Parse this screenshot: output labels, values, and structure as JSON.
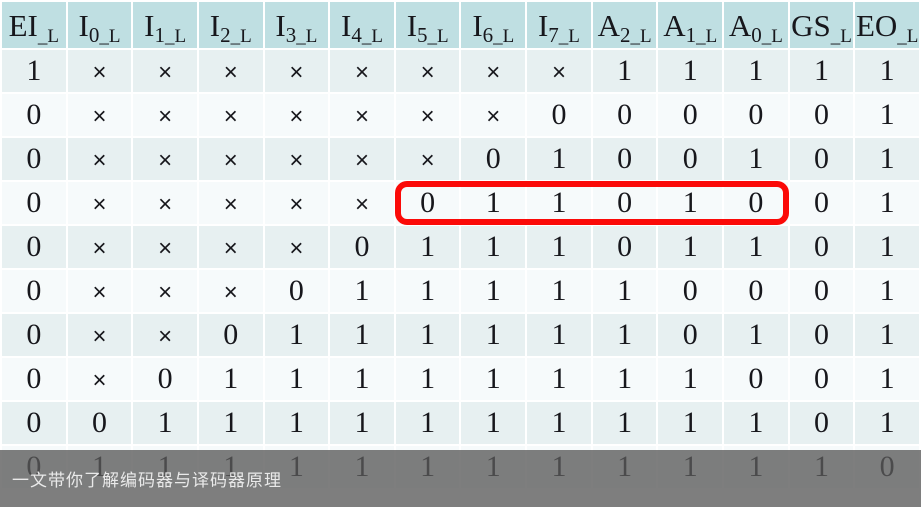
{
  "table": {
    "columns": [
      {
        "main": "EI",
        "sub": "_L",
        "index": ""
      },
      {
        "main": "I",
        "sub": "_L",
        "index": "0"
      },
      {
        "main": "I",
        "sub": "_L",
        "index": "1"
      },
      {
        "main": "I",
        "sub": "_L",
        "index": "2"
      },
      {
        "main": "I",
        "sub": "_L",
        "index": "3"
      },
      {
        "main": "I",
        "sub": "_L",
        "index": "4"
      },
      {
        "main": "I",
        "sub": "_L",
        "index": "5"
      },
      {
        "main": "I",
        "sub": "_L",
        "index": "6"
      },
      {
        "main": "I",
        "sub": "_L",
        "index": "7"
      },
      {
        "main": "A",
        "sub": "_L",
        "index": "2"
      },
      {
        "main": "A",
        "sub": "_L",
        "index": "1"
      },
      {
        "main": "A",
        "sub": "_L",
        "index": "0"
      },
      {
        "main": "GS",
        "sub": "_L",
        "index": ""
      },
      {
        "main": "EO",
        "sub": "_L",
        "index": ""
      }
    ],
    "column_labels": [
      "EI_L",
      "I0_L",
      "I1_L",
      "I2_L",
      "I3_L",
      "I4_L",
      "I5_L",
      "I6_L",
      "I7_L",
      "A2_L",
      "A1_L",
      "A0_L",
      "GS_L",
      "EO_L"
    ],
    "dont_care_symbol": "×",
    "rows": [
      [
        "1",
        "×",
        "×",
        "×",
        "×",
        "×",
        "×",
        "×",
        "×",
        "1",
        "1",
        "1",
        "1",
        "1"
      ],
      [
        "0",
        "×",
        "×",
        "×",
        "×",
        "×",
        "×",
        "×",
        "0",
        "0",
        "0",
        "0",
        "0",
        "1"
      ],
      [
        "0",
        "×",
        "×",
        "×",
        "×",
        "×",
        "×",
        "0",
        "1",
        "0",
        "0",
        "1",
        "0",
        "1"
      ],
      [
        "0",
        "×",
        "×",
        "×",
        "×",
        "×",
        "0",
        "1",
        "1",
        "0",
        "1",
        "0",
        "0",
        "1"
      ],
      [
        "0",
        "×",
        "×",
        "×",
        "×",
        "0",
        "1",
        "1",
        "1",
        "0",
        "1",
        "1",
        "0",
        "1"
      ],
      [
        "0",
        "×",
        "×",
        "×",
        "0",
        "1",
        "1",
        "1",
        "1",
        "1",
        "0",
        "0",
        "0",
        "1"
      ],
      [
        "0",
        "×",
        "×",
        "0",
        "1",
        "1",
        "1",
        "1",
        "1",
        "1",
        "0",
        "1",
        "0",
        "1"
      ],
      [
        "0",
        "×",
        "0",
        "1",
        "1",
        "1",
        "1",
        "1",
        "1",
        "1",
        "1",
        "0",
        "0",
        "1"
      ],
      [
        "0",
        "0",
        "1",
        "1",
        "1",
        "1",
        "1",
        "1",
        "1",
        "1",
        "1",
        "1",
        "0",
        "1"
      ],
      [
        "0",
        "1",
        "1",
        "1",
        "1",
        "1",
        "1",
        "1",
        "1",
        "1",
        "1",
        "1",
        "1",
        "0"
      ]
    ]
  },
  "highlight": {
    "row_index": 3,
    "start_column": "I5_L",
    "end_column": "A0_L",
    "values": [
      "0",
      "1",
      "1",
      "0",
      "1",
      "0"
    ],
    "color": "#fb0a08"
  },
  "watermark": {
    "text": "一文带你了解编码器与译码器原理",
    "band_color": "#5a5a5a",
    "text_color": "#e9e9e9"
  },
  "theme": {
    "header_bg": "#bfdfe2",
    "row_even_bg": "#e7f0f1",
    "row_odd_bg": "#f6fafb",
    "text_color": "#17171c",
    "page_bg": "#ffffff"
  }
}
